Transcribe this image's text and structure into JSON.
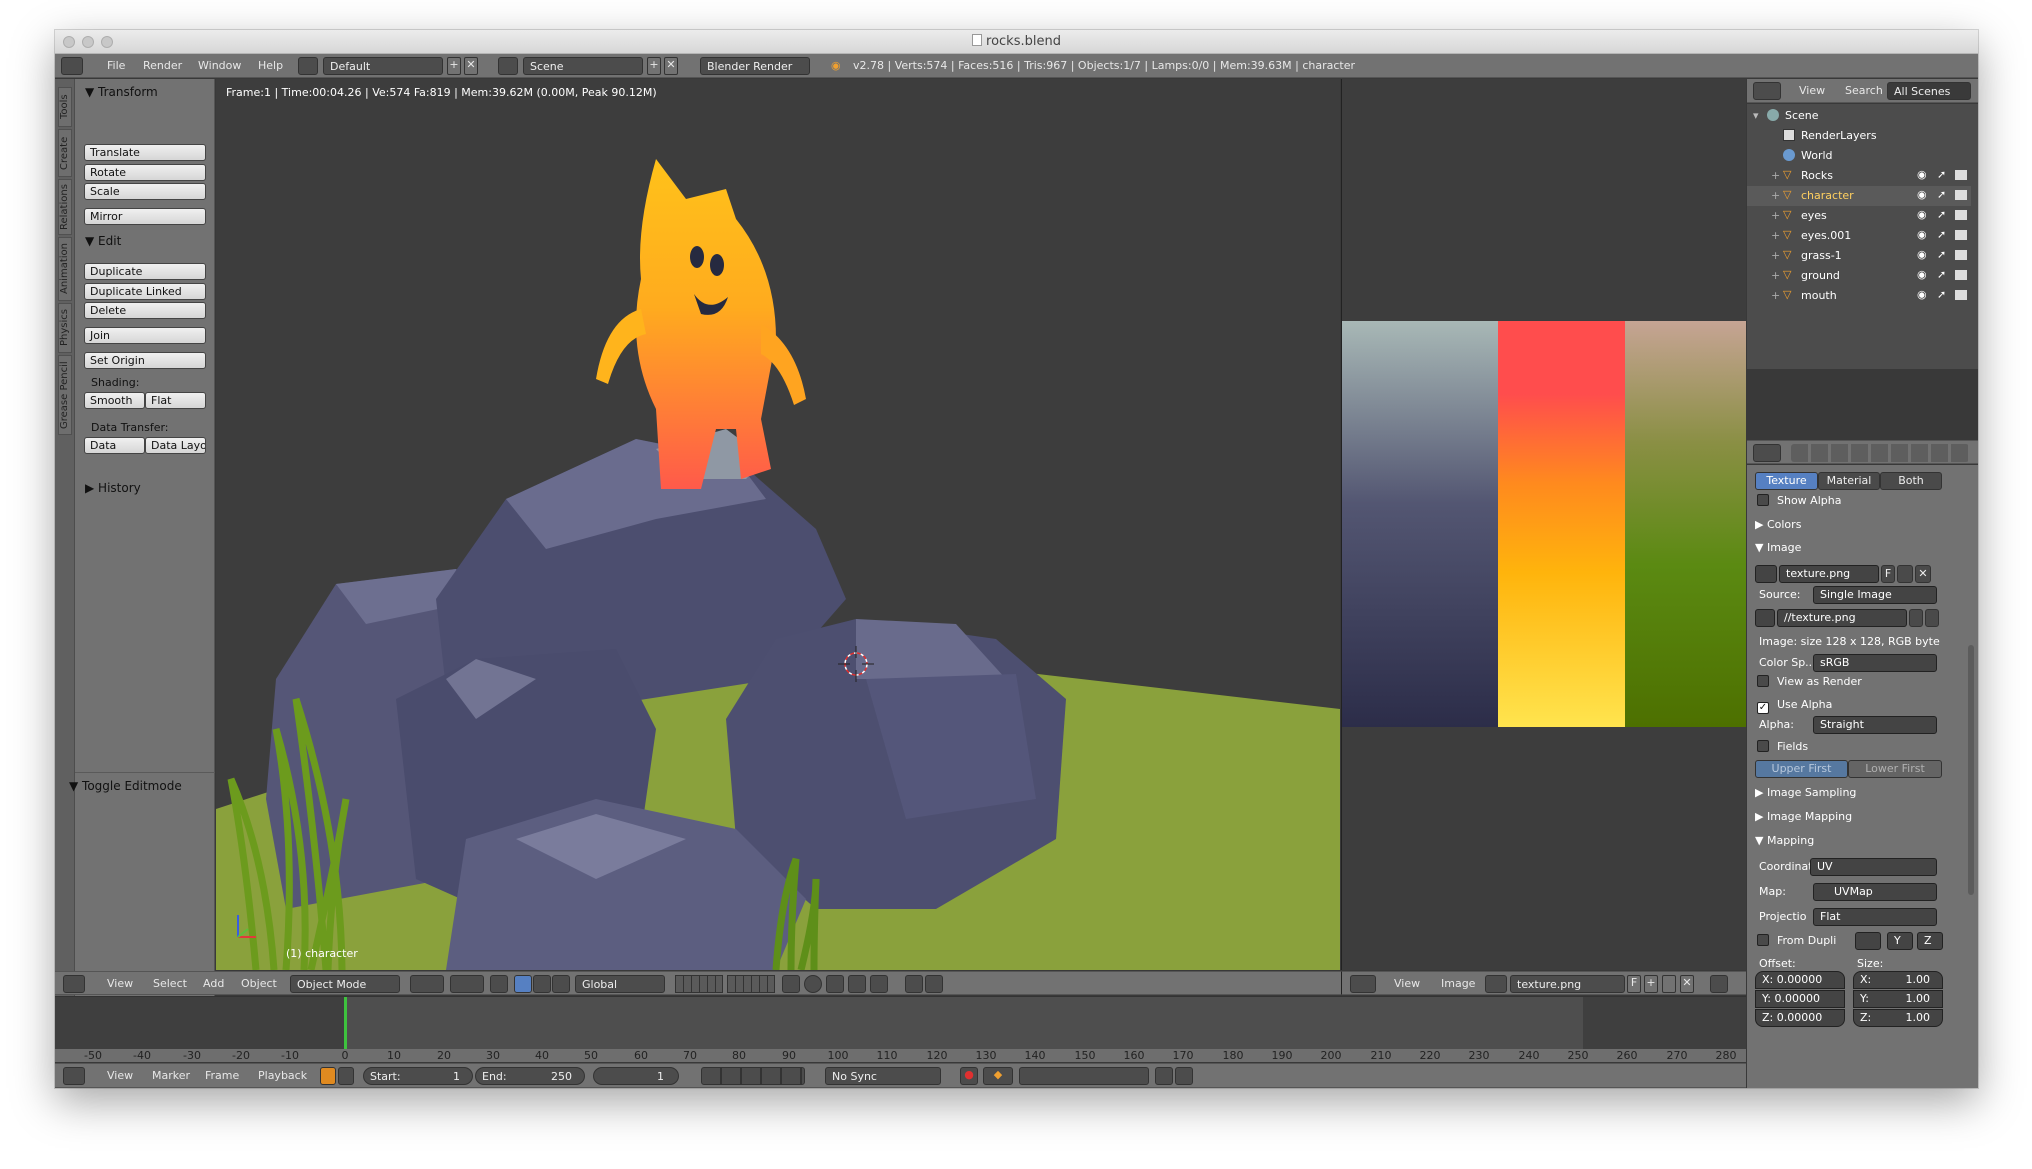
{
  "window": {
    "title": "rocks.blend"
  },
  "info_header": {
    "menus": [
      "File",
      "Render",
      "Window",
      "Help"
    ],
    "layout": "Default",
    "scene": "Scene",
    "engine": "Blender Render",
    "stats": "v2.78 | Verts:574 | Faces:516 | Tris:967 | Objects:1/7 | Lamps:0/0 | Mem:39.63M | character"
  },
  "tool_tabs": [
    "Tools",
    "Create",
    "Relations",
    "Animation",
    "Physics",
    "Grease Pencil"
  ],
  "tools": {
    "transform_title": "Transform",
    "translate": "Translate",
    "rotate": "Rotate",
    "scale": "Scale",
    "mirror": "Mirror",
    "edit_title": "Edit",
    "duplicate": "Duplicate",
    "duplicate_linked": "Duplicate Linked",
    "delete": "Delete",
    "join": "Join",
    "set_origin": "Set Origin",
    "shading_label": "Shading:",
    "smooth": "Smooth",
    "flat": "Flat",
    "data_transfer_label": "Data Transfer:",
    "data": "Data",
    "data_layo": "Data Layo",
    "history": "History",
    "toggle_editmode": "Toggle Editmode"
  },
  "viewport": {
    "stats": "Frame:1 | Time:00:04.26 | Ve:574 Fa:819 | Mem:39.62M (0.00M, Peak 90.12M)",
    "object_label": "(1) character",
    "header": {
      "view": "View",
      "select": "Select",
      "add": "Add",
      "object": "Object",
      "mode": "Object Mode",
      "orientation": "Global"
    }
  },
  "image_editor": {
    "view": "View",
    "image": "Image",
    "image_name": "texture.png",
    "fake_user": "F"
  },
  "outliner": {
    "view": "View",
    "search": "Search",
    "filter": "All Scenes",
    "items": [
      {
        "name": "Scene",
        "level": 0
      },
      {
        "name": "RenderLayers",
        "level": 1
      },
      {
        "name": "World",
        "level": 1
      },
      {
        "name": "Rocks",
        "level": 1
      },
      {
        "name": "character",
        "level": 1
      },
      {
        "name": "eyes",
        "level": 1
      },
      {
        "name": "eyes.001",
        "level": 1
      },
      {
        "name": "grass-1",
        "level": 1
      },
      {
        "name": "ground",
        "level": 1
      },
      {
        "name": "mouth",
        "level": 1
      }
    ]
  },
  "properties": {
    "tabs": [
      "Texture",
      "Material",
      "Both"
    ],
    "show_alpha": "Show Alpha",
    "colors": "Colors",
    "image_section": "Image",
    "image_name": "texture.png",
    "fake_user": "F",
    "source_label": "Source:",
    "source": "Single Image",
    "filepath": "//texture.png",
    "image_info": "Image: size 128 x 128, RGB byte",
    "colorspace_label": "Color Sp...",
    "colorspace": "sRGB",
    "view_as_render": "View as Render",
    "use_alpha": "Use Alpha",
    "alpha_label": "Alpha:",
    "alpha": "Straight",
    "fields": "Fields",
    "upper_first": "Upper First",
    "lower_first": "Lower First",
    "image_sampling": "Image Sampling",
    "image_mapping": "Image Mapping",
    "mapping": "Mapping",
    "coord_label": "Coordinat",
    "coord": "UV",
    "map_label": "Map:",
    "map": "UVMap",
    "projection_label": "Projectio",
    "projection": "Flat",
    "from_dupli": "From Dupli",
    "y": "Y",
    "z": "Z",
    "offset_label": "Offset:",
    "size_label": "Size:",
    "offset": {
      "x": "X: 0.00000",
      "y": "Y: 0.00000",
      "z": "Z: 0.00000"
    },
    "size": {
      "x": "X:",
      "y": "Y:",
      "z": "Z:",
      "xv": "1.00",
      "yv": "1.00",
      "zv": "1.00"
    }
  },
  "timeline": {
    "ticks": [
      "-50",
      "-40",
      "-30",
      "-20",
      "-10",
      "0",
      "10",
      "20",
      "30",
      "40",
      "50",
      "60",
      "70",
      "80",
      "90",
      "100",
      "110",
      "120",
      "130",
      "140",
      "150",
      "160",
      "170",
      "180",
      "190",
      "200",
      "210",
      "220",
      "230",
      "240",
      "250",
      "260",
      "270",
      "280"
    ],
    "view": "View",
    "marker": "Marker",
    "frame": "Frame",
    "playback": "Playback",
    "start_label": "Start:",
    "start": "1",
    "end_label": "End:",
    "end": "250",
    "current": "1",
    "sync": "No Sync"
  },
  "colors": {
    "window_bg": "#393939",
    "viewport_bg": "#3d3d3d",
    "rock": "#4e4f70",
    "grass": "#8aa13c",
    "character_top": "#ffc21a",
    "character_bottom": "#ff5a4a",
    "accent_blue": "#5680c2",
    "texture": [
      "#a8b8b6",
      "#ff4d4d",
      "#c6a494",
      "#2c2d49",
      "#ffe44e",
      "#4d7000"
    ]
  }
}
